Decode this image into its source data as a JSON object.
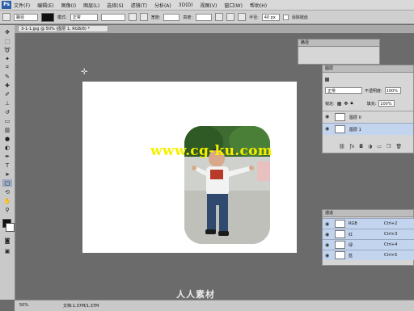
{
  "app": {
    "logo_text": "Ps"
  },
  "menu": {
    "items": [
      "文件(F)",
      "编辑(E)",
      "图像(I)",
      "图层(L)",
      "选择(S)",
      "滤镜(T)",
      "分析(A)",
      "3D(D)",
      "视图(V)",
      "窗口(W)",
      "帮助(H)"
    ]
  },
  "options": {
    "style_value": "路径",
    "mode_label": "模式:",
    "mode_value": "正常",
    "width_label": "宽度:",
    "height_label": "高度:",
    "radius_label": "半径:",
    "radius_value": "40 px",
    "antialias_label": "消除锯齿"
  },
  "document": {
    "tab_title": "3-1-1.jpg @ 50% (图层 1, RGB/8) *"
  },
  "canvas": {
    "watermark": "www.cg-ku.com"
  },
  "paths_panel": {
    "title": "路径"
  },
  "layers_panel": {
    "title": "图层",
    "blend_mode": "正常",
    "opacity_label": "不透明度:",
    "opacity_value": "100%",
    "lock_label": "锁定:",
    "fill_label": "填充:",
    "fill_value": "100%",
    "layers": [
      {
        "name": "图层 0"
      },
      {
        "name": "图层 1"
      }
    ]
  },
  "channels_panel": {
    "title": "通道",
    "channels": [
      {
        "name": "RGB",
        "shortcut": "Ctrl+2"
      },
      {
        "name": "红",
        "shortcut": "Ctrl+3"
      },
      {
        "name": "绿",
        "shortcut": "Ctrl+4"
      },
      {
        "name": "蓝",
        "shortcut": "Ctrl+5"
      }
    ]
  },
  "status": {
    "zoom": "50%",
    "doc_info": "文档:1.37M/1.37M"
  },
  "footer": {
    "brand": "人人素材"
  },
  "colors": {
    "watermark": "#f6f000",
    "selected_row": "#c3d4ee",
    "canvas_bg": "#6b6b6b"
  }
}
